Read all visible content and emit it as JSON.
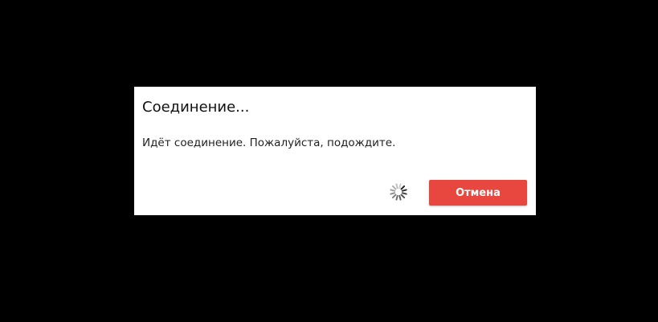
{
  "dialog": {
    "title": "Соединение...",
    "message": "Идёт соединение. Пожалуйста, подождите.",
    "spinner_icon": "loading-spinner-icon",
    "cancel_label": "Отмена"
  },
  "colors": {
    "backdrop": "#000000",
    "dialog_background": "#ffffff",
    "cancel_button": "#e8473f",
    "cancel_text": "#ffffff",
    "spinner": "#222222"
  }
}
